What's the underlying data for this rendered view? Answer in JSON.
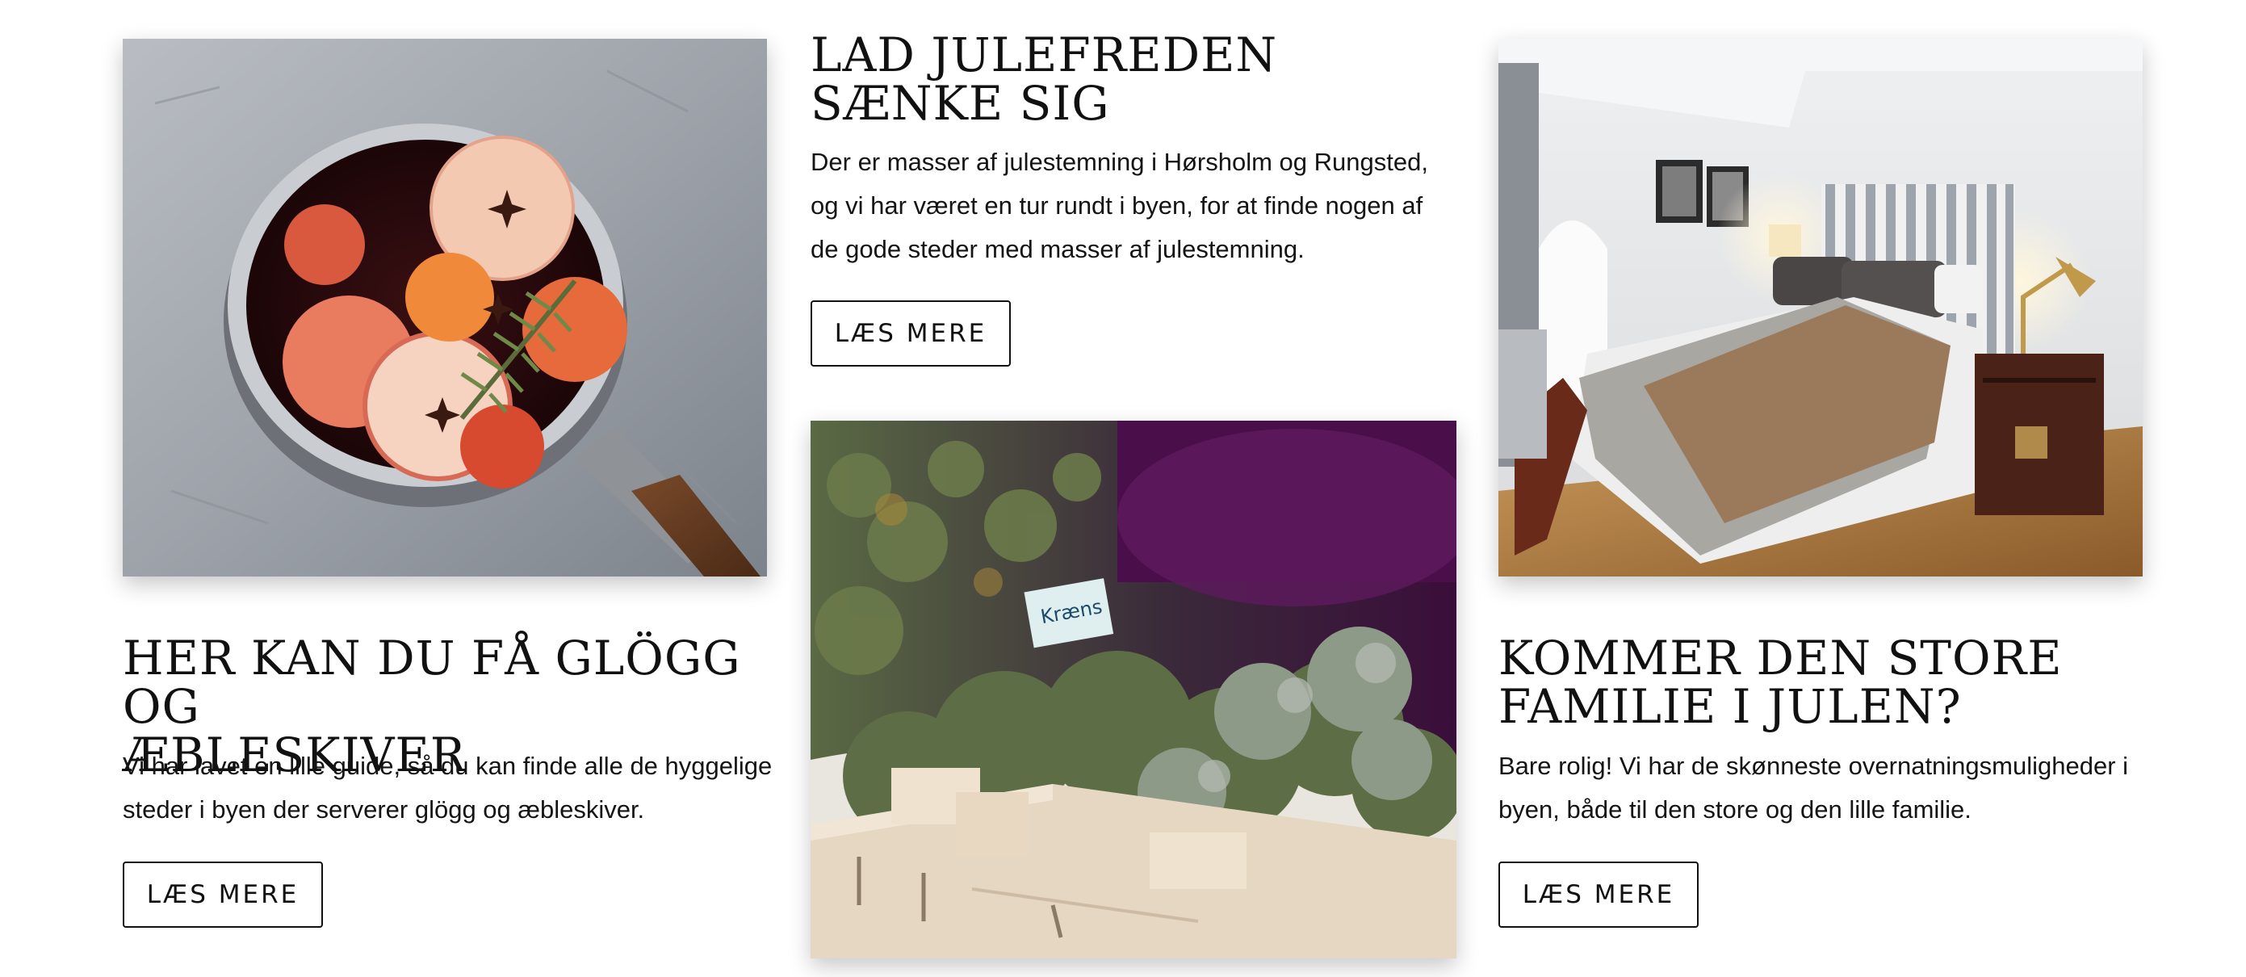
{
  "cards": [
    {
      "title_lines": [
        "HER KAN DU FÅ GLÖGG OG",
        "ÆBLESKIVER"
      ],
      "body": "Vi har lavet en lille guide, så du kan finde alle de hyggelige steder i byen der serverer glögg og æbleskiver.",
      "button": "LÆS MERE",
      "image": "mulled-wine-pot-photo"
    },
    {
      "title_lines": [
        "LAD JULEFREDEN",
        "SÆNKE SIG"
      ],
      "body": "Der er masser af julestemning i Hørsholm og Rungsted, og vi har været en tur rundt i byen, for at finde nogen af de gode steder med masser af julestemning.",
      "button": "LÆS MERE",
      "image": "christmas-greenery-crate-photo",
      "image_label": "Kræns"
    },
    {
      "title_lines": [
        "KOMMER DEN STORE",
        "FAMILIE I JULEN?"
      ],
      "body": "Bare rolig! Vi har de skønneste overnatningsmuligheder i byen, både til den store og den lille familie.",
      "button": "LÆS MERE",
      "image": "hotel-bedroom-photo"
    }
  ]
}
